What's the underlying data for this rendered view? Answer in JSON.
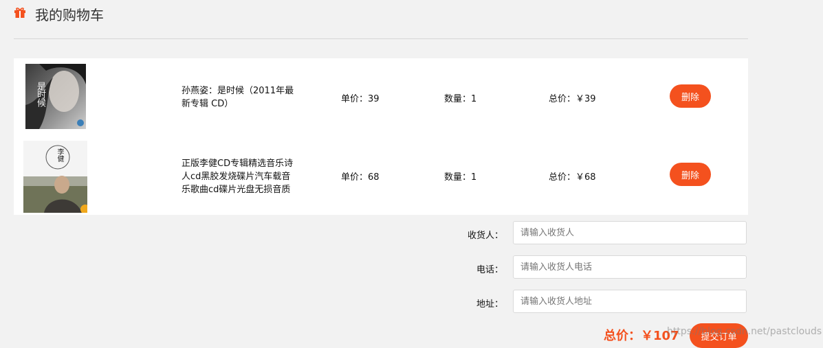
{
  "header": {
    "title": "我的购物车",
    "icon": "gift-icon",
    "accent_color": "#f4511e"
  },
  "cart": {
    "items": [
      {
        "name": "孙燕姿：是时候（2011年最新专辑 CD）",
        "price_label": "单价：39",
        "qty_label": "数量：1",
        "total_label": "总价：￥39",
        "delete_label": "删除",
        "cover_text": "是时候"
      },
      {
        "name": "正版李健CD专辑精选音乐诗人cd黑胶发烧碟片汽车载音乐歌曲cd碟片光盘无损音质",
        "price_label": "单价：68",
        "qty_label": "数量：1",
        "total_label": "总价：￥68",
        "delete_label": "删除",
        "cover_text": "李健"
      }
    ]
  },
  "form": {
    "receiver_label": "收货人：",
    "receiver_placeholder": "请输入收货人",
    "phone_label": "电话：",
    "phone_placeholder": "请输入收货人电话",
    "address_label": "地址：",
    "address_placeholder": "请输入收货人地址"
  },
  "summary": {
    "total_label": "总价：￥107",
    "submit_label": "提交订单"
  },
  "watermark": "https://blog.csdn.net/pastclouds"
}
